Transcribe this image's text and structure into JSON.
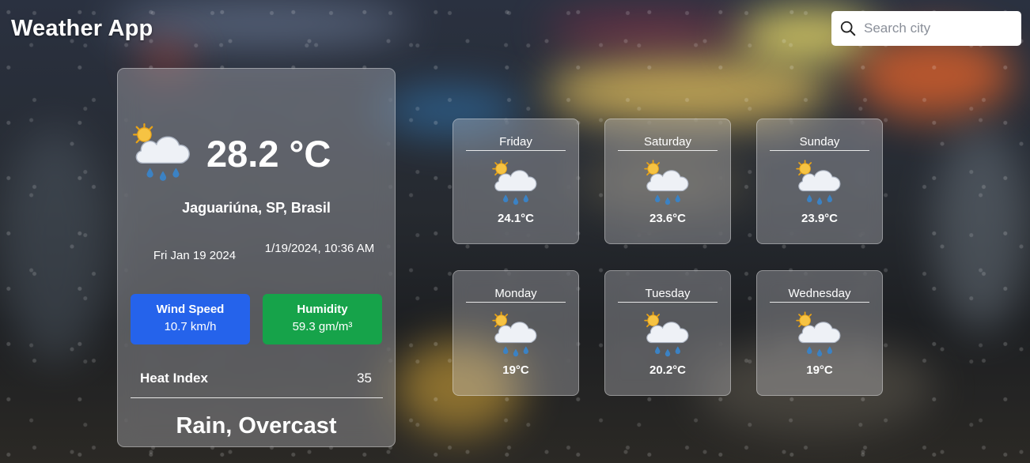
{
  "app": {
    "title": "Weather App"
  },
  "search": {
    "placeholder": "Search city",
    "icon": "search-icon"
  },
  "current": {
    "icon": "sun-behind-rain-cloud-icon",
    "temperature": "28.2 °C",
    "location": "Jaguariúna, SP, Brasil",
    "date": "Fri Jan 19 2024",
    "datetime": "1/19/2024, 10:36 AM",
    "wind": {
      "label": "Wind Speed",
      "value": "10.7 km/h",
      "color": "#2563eb"
    },
    "humidity": {
      "label": "Humidity",
      "value": "59.3 gm/m³",
      "color": "#16a34a"
    },
    "heat_index": {
      "label": "Heat Index",
      "value": "35"
    },
    "condition": "Rain, Overcast"
  },
  "forecast": [
    {
      "day": "Friday",
      "temp": "24.1°C",
      "icon": "sun-behind-rain-cloud-icon"
    },
    {
      "day": "Saturday",
      "temp": "23.6°C",
      "icon": "sun-behind-rain-cloud-icon"
    },
    {
      "day": "Sunday",
      "temp": "23.9°C",
      "icon": "sun-behind-rain-cloud-icon"
    },
    {
      "day": "Monday",
      "temp": "19°C",
      "icon": "sun-behind-rain-cloud-icon"
    },
    {
      "day": "Tuesday",
      "temp": "20.2°C",
      "icon": "sun-behind-rain-cloud-icon"
    },
    {
      "day": "Wednesday",
      "temp": "19°C",
      "icon": "sun-behind-rain-cloud-icon"
    }
  ]
}
